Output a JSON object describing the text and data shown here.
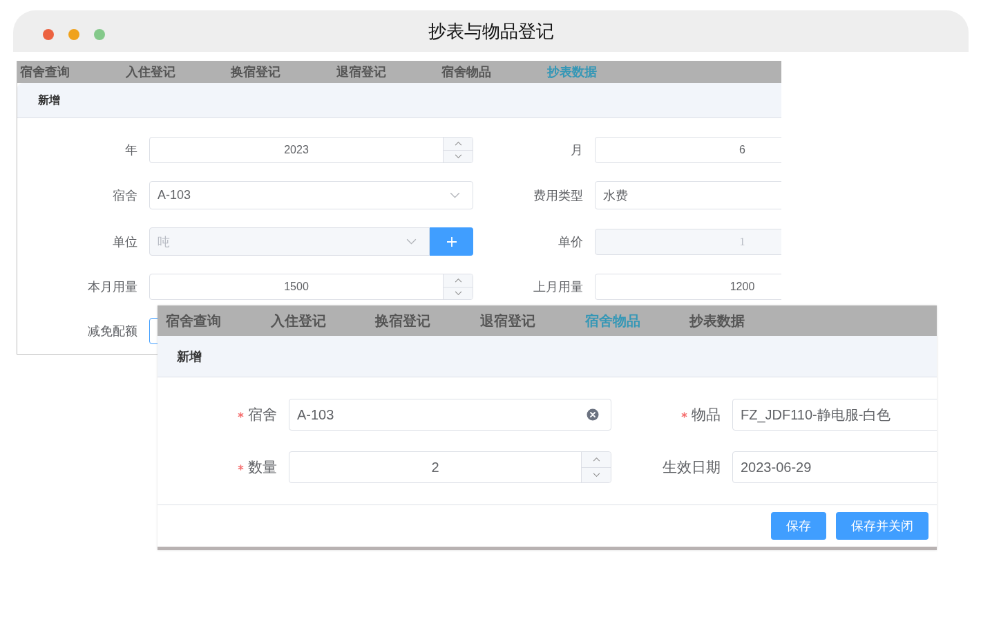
{
  "window": {
    "title": "抄表与物品登记"
  },
  "panels": [
    {
      "tabs": [
        {
          "label": "宿舍查询",
          "selected": false
        },
        {
          "label": "入住登记",
          "selected": false
        },
        {
          "label": "换宿登记",
          "selected": false
        },
        {
          "label": "退宿登记",
          "selected": false
        },
        {
          "label": "宿舍物品",
          "selected": false
        },
        {
          "label": "抄表数据",
          "selected": true
        }
      ],
      "header": "新增",
      "fields": [
        {
          "label": "年",
          "kind": "stepper",
          "value": "2023",
          "required": false,
          "disabled": false,
          "focused": false
        },
        {
          "label": "月",
          "kind": "number",
          "value": "6",
          "required": false,
          "disabled": false,
          "focused": false
        },
        {
          "label": "宿舍",
          "kind": "select",
          "value": "A-103",
          "required": false,
          "disabled": false,
          "focused": false
        },
        {
          "label": "费用类型",
          "kind": "text",
          "value": "水费",
          "required": false,
          "disabled": false,
          "focused": false
        },
        {
          "label": "单位",
          "kind": "select_add",
          "value": "吨",
          "required": false,
          "disabled": true,
          "focused": false
        },
        {
          "label": "单价",
          "kind": "number",
          "value": "1",
          "required": false,
          "disabled": true,
          "focused": false
        },
        {
          "label": "本月用量",
          "kind": "stepper",
          "value": "1500",
          "required": false,
          "disabled": false,
          "focused": false
        },
        {
          "label": "上月用量",
          "kind": "number",
          "value": "1200",
          "required": false,
          "disabled": false,
          "focused": false
        },
        {
          "label": "减免配额",
          "kind": "number",
          "required": false,
          "disabled": false,
          "focused": true
        }
      ]
    },
    {
      "tabs": [
        {
          "label": "宿舍查询",
          "selected": false
        },
        {
          "label": "入住登记",
          "selected": false
        },
        {
          "label": "换宿登记",
          "selected": false
        },
        {
          "label": "退宿登记",
          "selected": false
        },
        {
          "label": "宿舍物品",
          "selected": true
        },
        {
          "label": "抄表数据",
          "selected": false
        }
      ],
      "header": "新增",
      "fields": [
        {
          "label": "宿舍",
          "kind": "select_clearable",
          "value": "A-103",
          "required": true,
          "disabled": false,
          "focused": false
        },
        {
          "label": "物品",
          "kind": "text",
          "value": "FZ_JDF110-静电服-白色",
          "required": true,
          "disabled": false,
          "focused": false
        },
        {
          "label": "数量",
          "kind": "stepper",
          "value": "2",
          "required": true,
          "disabled": false,
          "focused": false
        },
        {
          "label": "生效日期",
          "kind": "text",
          "value": "2023-06-29",
          "required": false,
          "disabled": false,
          "focused": false
        }
      ],
      "buttons": [
        "保存",
        "保存并关闭"
      ]
    }
  ]
}
